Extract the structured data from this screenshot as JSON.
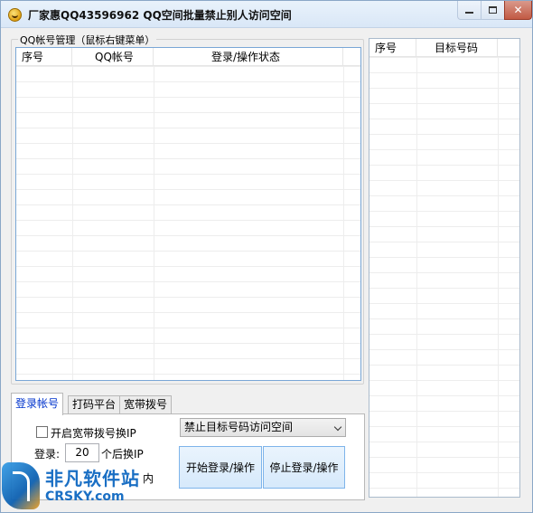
{
  "window": {
    "title": "厂家惠QQ43596962 QQ空间批量禁止别人访问空间",
    "buttons": {
      "minimize": "—",
      "maximize": "☐",
      "close": "✕"
    }
  },
  "accounts": {
    "group_title": "QQ帐号管理（鼠标右键菜单）",
    "columns": [
      "序号",
      "QQ帐号",
      "登录/操作状态"
    ]
  },
  "targets": {
    "columns": [
      "序号",
      "目标号码"
    ]
  },
  "tabs": [
    {
      "label": "登录帐号",
      "active": true
    },
    {
      "label": "打码平台",
      "active": false
    },
    {
      "label": "宽带拨号",
      "active": false
    }
  ],
  "login_panel": {
    "broadband_checkbox_label": "开启宽带拨号换IP",
    "broadband_checked": false,
    "login_label": "登录:",
    "login_count": "20",
    "after_label": "个后换IP",
    "obscured_suffix": "内",
    "action_select": "禁止目标号码访问空间",
    "start_button": "开始登录/操作",
    "stop_button": "停止登录/操作"
  },
  "watermark": {
    "cn": "非凡软件站",
    "en": "CRSKY.com"
  }
}
